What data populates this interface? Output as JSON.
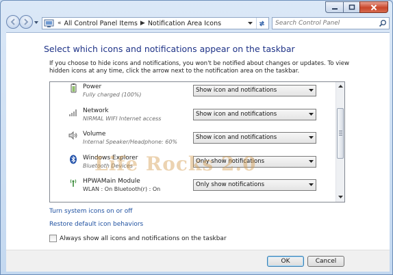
{
  "window": {
    "breadcrumb": [
      "All Control Panel Items",
      "Notification Area Icons"
    ],
    "search_placeholder": "Search Control Panel"
  },
  "main": {
    "heading": "Select which icons and notifications appear on the taskbar",
    "intro": "If you choose to hide icons and notifications, you won't be notified about changes or updates. To view hidden icons at any time, click the arrow next to the notification area on the taskbar.",
    "rows": [
      {
        "icon": "power-icon",
        "name": "Power",
        "desc": "Fully charged (100%)",
        "behavior": "Show icon and notifications"
      },
      {
        "icon": "network-icon",
        "name": "Network",
        "desc": "NIRMAL WIFI Internet access",
        "behavior": "Show icon and notifications"
      },
      {
        "icon": "volume-icon",
        "name": "Volume",
        "desc": "Internal Speaker/Headphone: 60%",
        "behavior": "Show icon and notifications"
      },
      {
        "icon": "bluetooth-icon",
        "name": "Windows Explorer",
        "desc": "Bluetooth Devices",
        "behavior": "Only show notifications"
      },
      {
        "icon": "wlan-antenna-icon",
        "name": "HPWAMain Module",
        "desc": "WLAN  : On Bluetooth(r) : On",
        "behavior": "Only show notifications"
      }
    ],
    "links": {
      "system_icons": "Turn system icons on or off",
      "restore": "Restore default icon behaviors"
    },
    "always_show_label": "Always show all icons and notifications on the taskbar",
    "always_show_checked": false
  },
  "footer": {
    "ok_label": "OK",
    "cancel_label": "Cancel"
  },
  "watermark": "Life Rocks 2.0"
}
